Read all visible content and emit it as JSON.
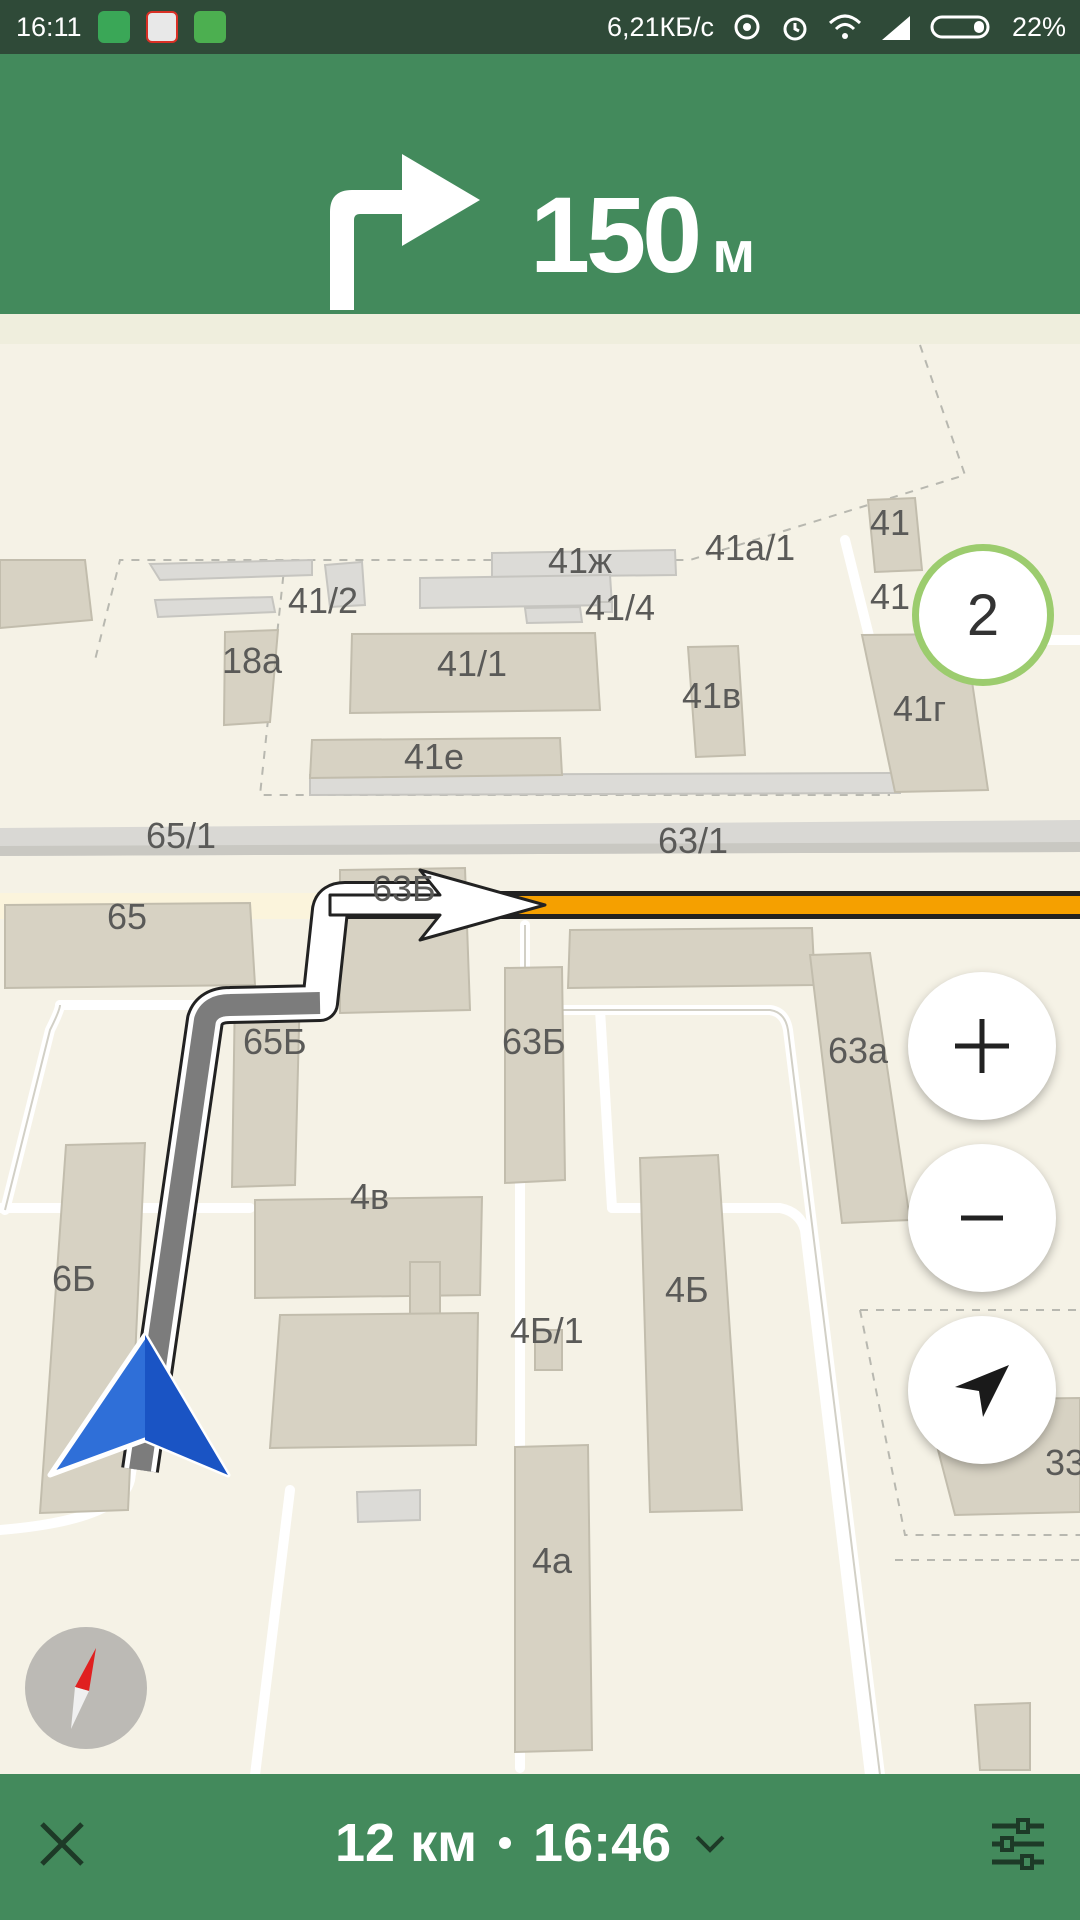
{
  "status_bar": {
    "time": "16:11",
    "speed": "6,21КБ/с",
    "battery": "22%",
    "icons": [
      "maps-app-icon",
      "gmail-icon",
      "google-maps-icon",
      "hotspot-icon",
      "alarm-icon",
      "wifi-icon",
      "signal-icon",
      "battery-icon"
    ]
  },
  "navigation": {
    "maneuver_icon": "turn-right-icon",
    "distance_value": "150",
    "distance_unit": "м"
  },
  "map": {
    "building_labels": [
      "41",
      "41а/1",
      "41ж",
      "41/2",
      "41/4",
      "41",
      "18а",
      "41/1",
      "41в",
      "41г",
      "41е",
      "65/1",
      "63/1",
      "65",
      "63Б",
      "65Б",
      "63Б",
      "63а",
      "6Б",
      "4в",
      "4Б",
      "4Б/1",
      "4а",
      "33"
    ],
    "route_color": "#f5a000",
    "speed_camera_count": "2"
  },
  "controls": {
    "zoom_in_icon": "plus-icon",
    "zoom_out_icon": "minus-icon",
    "locate_icon": "location-arrow-icon",
    "compass_icon": "compass-icon"
  },
  "bottom_bar": {
    "distance": "12 км",
    "arrival_time": "16:46",
    "close_icon": "close-icon",
    "expand_icon": "chevron-down-icon",
    "settings_icon": "sliders-icon"
  },
  "colors": {
    "header_green": "#438a5c",
    "status_bar": "#2f4a38",
    "map_background": "#f5f2e6",
    "camera_ring": "#9ccc6e",
    "position_arrow": "#2f6fd8"
  }
}
